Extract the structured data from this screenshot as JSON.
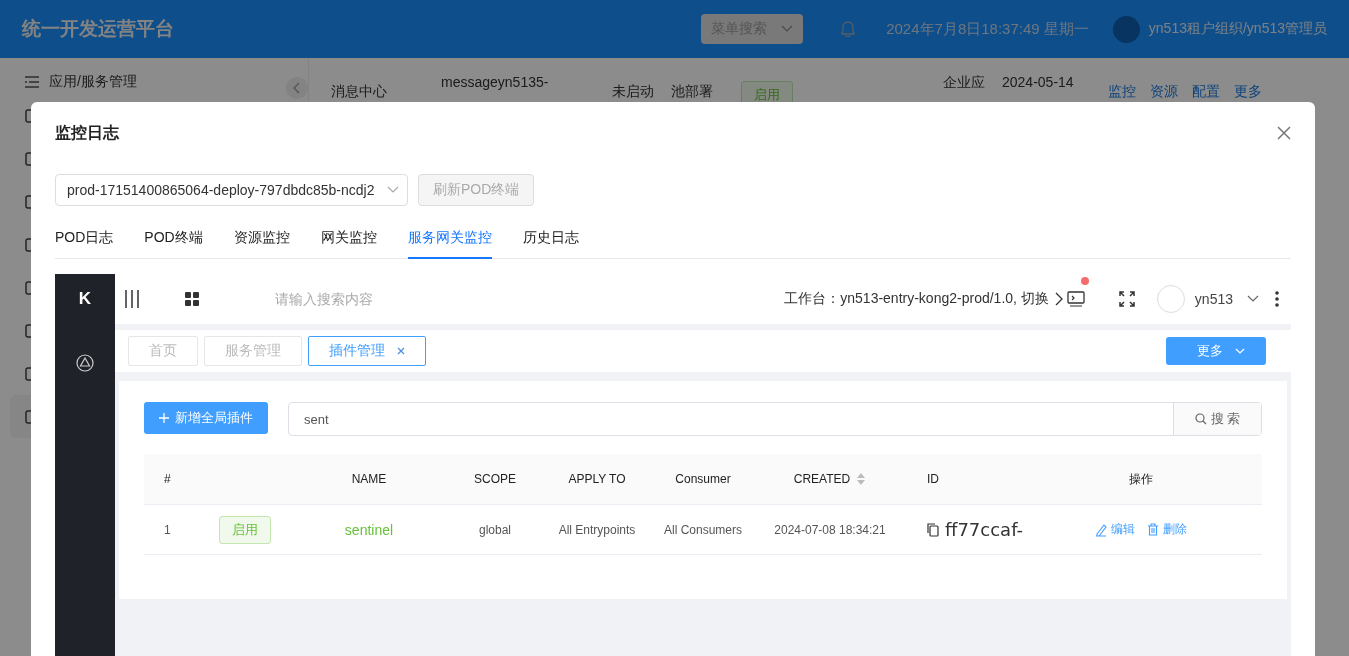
{
  "background_page": {
    "header": {
      "title": "统一开发运营平台",
      "menu_search": {
        "placeholder": "菜单搜索"
      },
      "datetime": "2024年7月8日18:37:49 星期一",
      "user": "yn513租户组织/yn513管理员"
    },
    "sidebar": {
      "items": [
        {
          "label": "应用/服务管理"
        }
      ]
    },
    "row": {
      "name": "消息中心",
      "code": "messageyn5135-",
      "state": "未启动",
      "deploy": "池部署",
      "status": {
        "label": "启用",
        "enabled": true
      },
      "type": "企业应",
      "date": "2024-05-14",
      "actions": [
        "监控",
        "资源",
        "配置",
        "更多"
      ]
    }
  },
  "modal": {
    "title": "监控日志",
    "pod_select": {
      "value": "prod-17151400865064-deploy-797dbdc85b-ncdj2"
    },
    "refresh_button": {
      "label": "刷新POD终端",
      "disabled": true
    },
    "tabs": [
      {
        "label": "POD日志",
        "selected": false
      },
      {
        "label": "POD终端",
        "selected": false
      },
      {
        "label": "资源监控",
        "selected": false
      },
      {
        "label": "网关监控",
        "selected": false
      },
      {
        "label": "服务网关监控",
        "selected": true
      },
      {
        "label": "历史日志",
        "selected": false
      }
    ],
    "gateway": {
      "logo": "K",
      "search": {
        "placeholder": "请输入搜索内容"
      },
      "workspace": "工作台：yn513-entry-kong2-prod/1.0, 切换",
      "has_notification": true,
      "user": "yn513",
      "page_tabs": [
        {
          "label": "首页",
          "selected": false,
          "closable": false
        },
        {
          "label": "服务管理",
          "selected": false,
          "closable": false
        },
        {
          "label": "插件管理",
          "selected": true,
          "closable": true
        }
      ],
      "more_button": "更多",
      "add_button": "新增全局插件",
      "filter": {
        "value": "sent"
      },
      "search_button": "搜 索",
      "table": {
        "columns": [
          {
            "kind": "index",
            "label": "#"
          },
          {
            "kind": "blank"
          },
          {
            "kind": "center",
            "label": "NAME"
          },
          {
            "kind": "center",
            "label": "SCOPE"
          },
          {
            "kind": "center",
            "label": "APPLY TO"
          },
          {
            "kind": "center",
            "label": "Consumer"
          },
          {
            "kind": "sortable",
            "label": "CREATED"
          },
          {
            "kind": "left",
            "label": "ID"
          },
          {
            "kind": "center",
            "label": "操作"
          }
        ],
        "rows": [
          {
            "index": "1",
            "status": {
              "label": "启用",
              "enabled": true
            },
            "name": "sentinel",
            "scope": "global",
            "apply_to": "All Entrypoints",
            "consumer": "All Consumers",
            "created": "2024-07-08 18:34:21",
            "id": "ff77ccaf-",
            "actions": [
              "编辑",
              "删除"
            ]
          }
        ]
      }
    }
  }
}
